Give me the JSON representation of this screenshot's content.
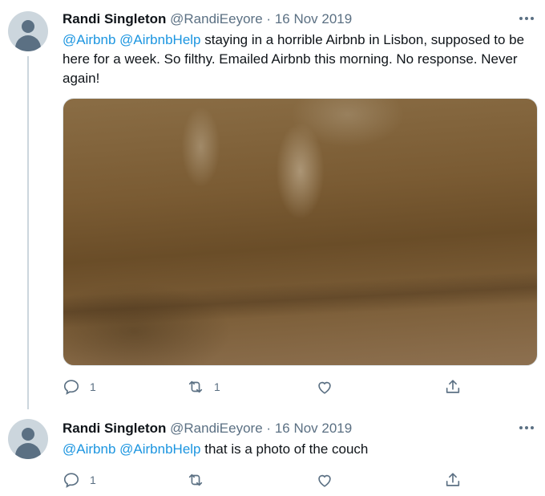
{
  "tweets": [
    {
      "name": "Randi Singleton",
      "handle": "@RandiEeyore",
      "separator": "·",
      "date": "16 Nov 2019",
      "mentions": [
        "@Airbnb",
        "@AirbnbHelp"
      ],
      "text": "staying in a horrible Airbnb in Lisbon, supposed to be here for a week. So filthy. Emailed Airbnb this morning.  No response. Never again!",
      "media_alt": "photo of the couch",
      "reply_count": "1",
      "retweet_count": "1",
      "like_count": ""
    },
    {
      "name": "Randi Singleton",
      "handle": "@RandiEeyore",
      "separator": "·",
      "date": "16 Nov 2019",
      "mentions": [
        "@Airbnb",
        "@AirbnbHelp"
      ],
      "text": "that is a photo of the couch",
      "reply_count": "1",
      "retweet_count": "",
      "like_count": ""
    }
  ],
  "icons": {
    "reply": "reply-icon",
    "retweet": "retweet-icon",
    "like": "like-icon",
    "share": "share-icon",
    "more": "more-icon"
  },
  "colors": {
    "mention": "#1b95e0",
    "secondary_text": "#5b7083",
    "thread_line": "#ccd6dd"
  }
}
